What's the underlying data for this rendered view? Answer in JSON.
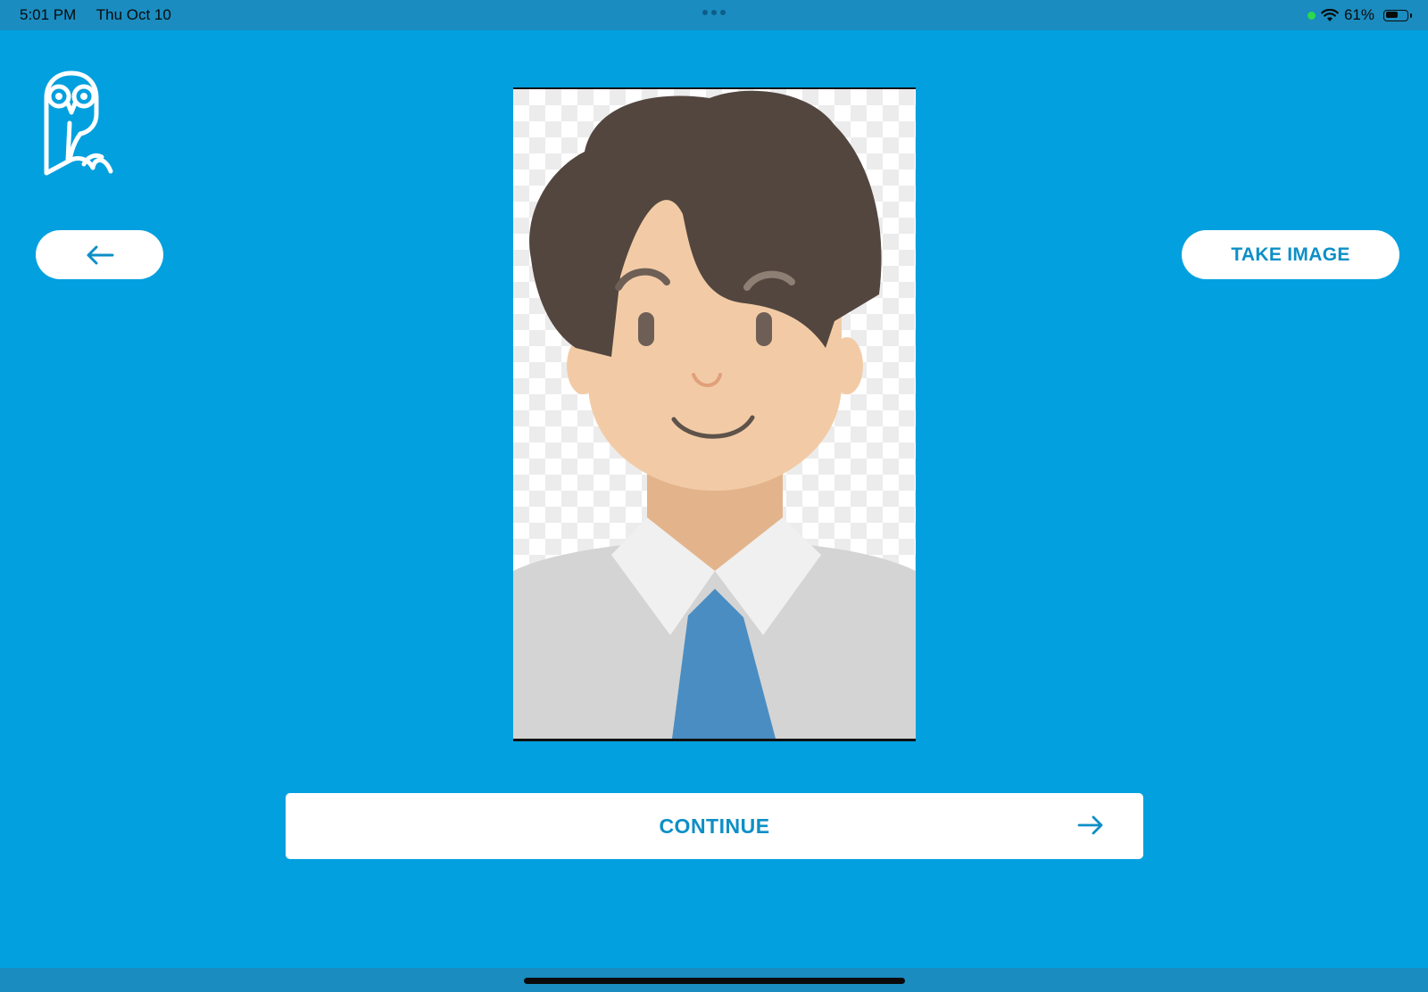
{
  "status_bar": {
    "time": "5:01 PM",
    "date": "Thu Oct 10",
    "battery_percent": "61%",
    "battery_level": 0.61,
    "wifi_icon": "wifi-icon",
    "battery_icon": "battery-icon"
  },
  "header": {
    "logo_icon": "owl-logo-icon"
  },
  "toolbar": {
    "back_icon": "arrow-left-icon",
    "take_image_label": "TAKE IMAGE"
  },
  "main": {
    "portrait_icon": "avatar-placeholder-image"
  },
  "footer": {
    "continue_label": "CONTINUE",
    "continue_icon": "arrow-right-icon"
  },
  "colors": {
    "background": "#02a0df",
    "accent_text": "#0d8fc6",
    "button_bg": "#ffffff"
  }
}
